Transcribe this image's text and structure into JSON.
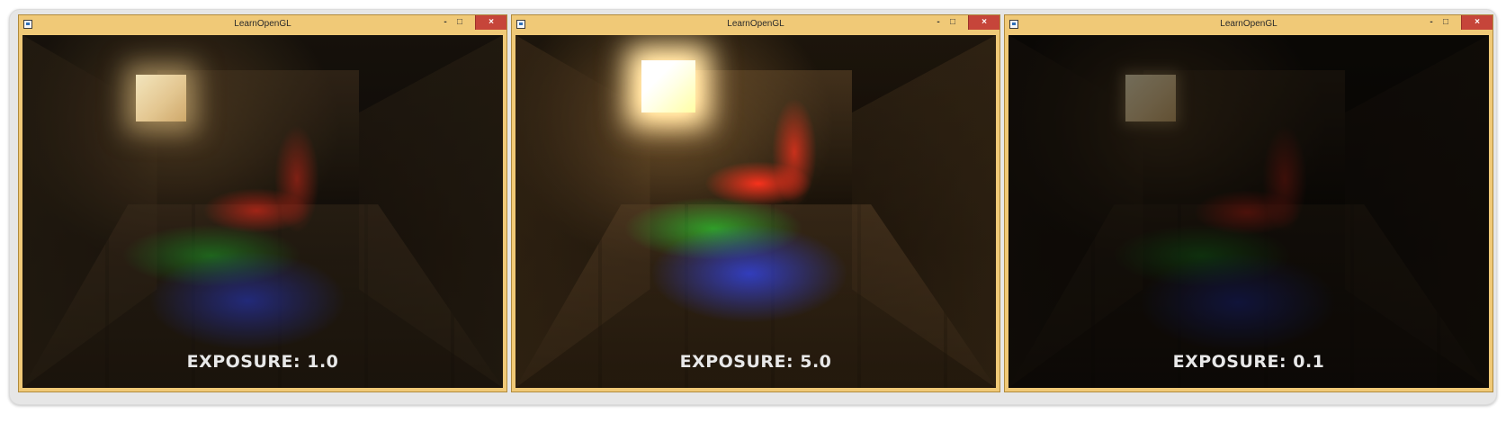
{
  "windows": [
    {
      "title": "LearnOpenGL",
      "exposure_label": "EXPOSURE: 1.0"
    },
    {
      "title": "LearnOpenGL",
      "exposure_label": "EXPOSURE: 5.0"
    },
    {
      "title": "LearnOpenGL",
      "exposure_label": "EXPOSURE: 0.1"
    }
  ],
  "controls": {
    "minimize": "-",
    "maximize": "□",
    "close": "×"
  },
  "colors": {
    "window_chrome": "#f0c977",
    "close_button": "#c6453a",
    "light_red": "#d22819",
    "light_green": "#1eaa28",
    "light_blue": "#283cdc"
  },
  "icons": [
    "app-icon",
    "minimize-icon",
    "maximize-icon",
    "close-icon"
  ]
}
